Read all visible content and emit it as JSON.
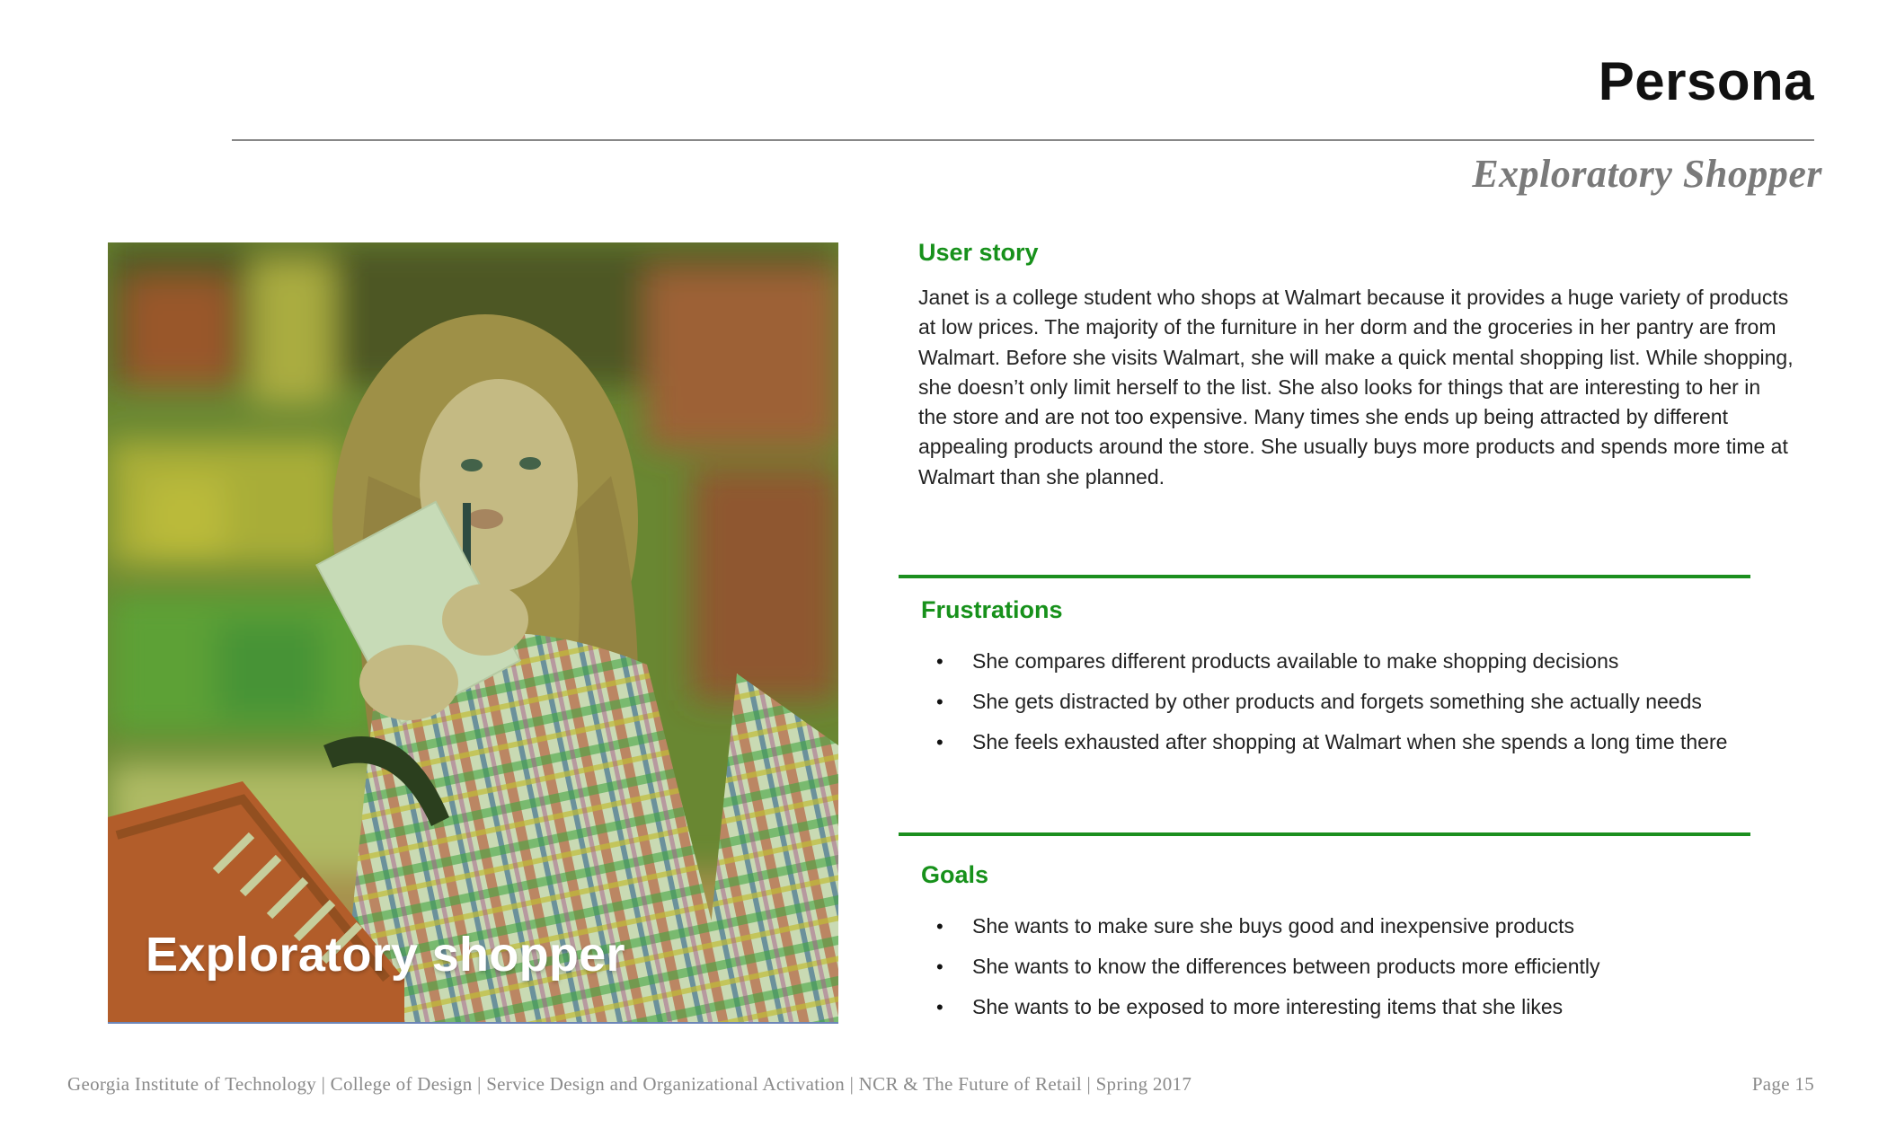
{
  "header": {
    "title": "Persona",
    "subtitle": "Exploratory Shopper"
  },
  "photo": {
    "caption": "Exploratory shopper",
    "overlay_color": "#5aa02c"
  },
  "user_story": {
    "heading": "User story",
    "text": "Janet is a college student who shops at Walmart because it provides a huge variety of products at low prices. The majority of the furniture in her dorm and the groceries in her pantry are from Walmart. Before she visits Walmart, she will make a quick mental shopping list. While shopping, she doesn’t only limit herself to the list. She also looks for things that are interesting to her in the store and are not too expensive. Many times she ends up being attracted by different appealing products around the store. She usually buys more products and spends more time at Walmart than she planned."
  },
  "frustrations": {
    "heading": "Frustrations",
    "items": [
      "She compares different products available to make shopping decisions",
      "She gets distracted by other products and forgets something she actually needs",
      "She feels exhausted after shopping at Walmart when she spends a long time there"
    ]
  },
  "goals": {
    "heading": "Goals",
    "items": [
      "She wants to make sure she buys good and inexpensive products",
      "She wants to know the differences between products more efficiently",
      "She wants to be exposed to more interesting items that she likes"
    ]
  },
  "footer": {
    "text": "Georgia Institute of Technology | College of Design | Service Design and Organizational Activation | NCR & The Future of Retail | Spring 2017",
    "page": "Page 15"
  },
  "colors": {
    "accent_green": "#17911b",
    "rule_green": "#1b8f1e",
    "footer_gray": "#8a8a8a"
  }
}
